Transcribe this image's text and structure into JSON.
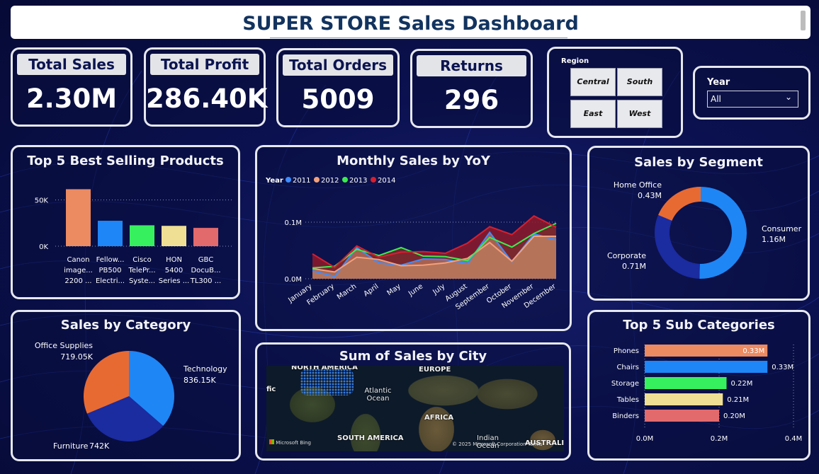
{
  "header": {
    "title": "SUPER STORE Sales Dashboard"
  },
  "kpis": [
    {
      "label": "Total Sales",
      "value": "2.30M"
    },
    {
      "label": "Total Profit",
      "value": "286.40K"
    },
    {
      "label": "Total Orders",
      "value": "5009"
    },
    {
      "label": "Returns",
      "value": "296"
    }
  ],
  "region": {
    "label": "Region",
    "options": [
      "Central",
      "South",
      "East",
      "West"
    ]
  },
  "year_filter": {
    "label": "Year",
    "value": "All"
  },
  "panels": {
    "top5": "Top 5 Best Selling Products",
    "monthly": "Monthly Sales by YoY",
    "segment": "Sales by Segment",
    "category": "Sales by Category",
    "city": "Sum of Sales by City",
    "subcat": "Top 5 Sub Categories"
  },
  "chart_data": [
    {
      "type": "bar",
      "id": "top5",
      "categories": [
        "Canon image... 2200 ...",
        "Fellow... PB500 Electri...",
        "Cisco TelePr... Syste...",
        "HON 5400 Series ...",
        "GBC DocuB... TL300 ..."
      ],
      "category_lines": [
        [
          "Canon",
          "image...",
          "2200 ..."
        ],
        [
          "Fellow...",
          "PB500",
          "Electri..."
        ],
        [
          "Cisco",
          "TelePr...",
          "Syste..."
        ],
        [
          "HON",
          "5400",
          "Series ..."
        ],
        [
          "GBC",
          "DocuB...",
          "TL300 ..."
        ]
      ],
      "values": [
        61600,
        27500,
        22600,
        22000,
        19800
      ],
      "colors": [
        "#ec8a62",
        "#1e86f7",
        "#37f05e",
        "#eedf95",
        "#e36a6c"
      ],
      "ylim": [
        0,
        65000
      ],
      "ticks": [
        {
          "v": 0,
          "label": "0K"
        },
        {
          "v": 50000,
          "label": "50K"
        }
      ]
    },
    {
      "type": "area",
      "id": "monthly",
      "legend_title": "Year",
      "categories": [
        "January",
        "February",
        "March",
        "April",
        "May",
        "June",
        "July",
        "August",
        "September",
        "October",
        "November",
        "December"
      ],
      "series": [
        {
          "name": "2011",
          "color": "#3e8cff",
          "values": [
            0.014,
            0.004,
            0.055,
            0.028,
            0.024,
            0.035,
            0.034,
            0.027,
            0.082,
            0.03,
            0.079,
            0.069
          ]
        },
        {
          "name": "2012",
          "color": "#f2a17c",
          "values": [
            0.018,
            0.012,
            0.038,
            0.034,
            0.023,
            0.024,
            0.028,
            0.036,
            0.064,
            0.031,
            0.075,
            0.075
          ]
        },
        {
          "name": "2013",
          "color": "#3bec4e",
          "values": [
            0.019,
            0.022,
            0.052,
            0.041,
            0.055,
            0.04,
            0.039,
            0.032,
            0.073,
            0.056,
            0.08,
            0.098
          ]
        },
        {
          "name": "2014",
          "color": "#d61f2f",
          "values": [
            0.044,
            0.02,
            0.058,
            0.038,
            0.047,
            0.048,
            0.045,
            0.063,
            0.092,
            0.078,
            0.111,
            0.091
          ]
        }
      ],
      "ylim": [
        0,
        0.12
      ],
      "ticks": [
        {
          "v": 0,
          "label": "0.0M"
        },
        {
          "v": 0.1,
          "label": "0.1M"
        }
      ]
    },
    {
      "type": "pie",
      "id": "segment",
      "donut": true,
      "labels": [
        "Consumer",
        "Corporate",
        "Home Office"
      ],
      "values": [
        1.16,
        0.71,
        0.43
      ],
      "value_labels": [
        "1.16M",
        "0.71M",
        "0.43M"
      ],
      "colors": [
        "#1f86f5",
        "#1b2ba0",
        "#e86a33"
      ]
    },
    {
      "type": "pie",
      "id": "category",
      "labels": [
        "Technology",
        "Furniture",
        "Office Supplies"
      ],
      "values": [
        836.15,
        742,
        719.05
      ],
      "value_labels": [
        "836.15K",
        "742K",
        "719.05K"
      ],
      "colors": [
        "#1f86f5",
        "#1b2ba0",
        "#e86a33"
      ]
    },
    {
      "type": "bar",
      "id": "subcat",
      "orientation": "horizontal",
      "categories": [
        "Phones",
        "Chairs",
        "Storage",
        "Tables",
        "Binders"
      ],
      "values": [
        0.33,
        0.33,
        0.22,
        0.21,
        0.2
      ],
      "value_labels": [
        "0.33M",
        "0.33M",
        "0.22M",
        "0.21M",
        "0.20M"
      ],
      "colors": [
        "#ec8a62",
        "#1e86f7",
        "#37f05e",
        "#eedf95",
        "#e36a6c"
      ],
      "xlim": [
        0,
        0.4
      ],
      "ticks": [
        {
          "v": 0,
          "label": "0.0M"
        },
        {
          "v": 0.2,
          "label": "0.2M"
        },
        {
          "v": 0.4,
          "label": "0.4M"
        }
      ]
    }
  ],
  "map": {
    "labels": [
      "NORTH AMERICA",
      "EUROPE",
      "Atlantic Ocean",
      "AFRICA",
      "SOUTH AMERICA",
      "Indian Ocean",
      "AUSTRALIA",
      "fic"
    ],
    "brand": "Microsoft Bing",
    "copyright": "© 2025 Microsoft Corporation Terms"
  }
}
